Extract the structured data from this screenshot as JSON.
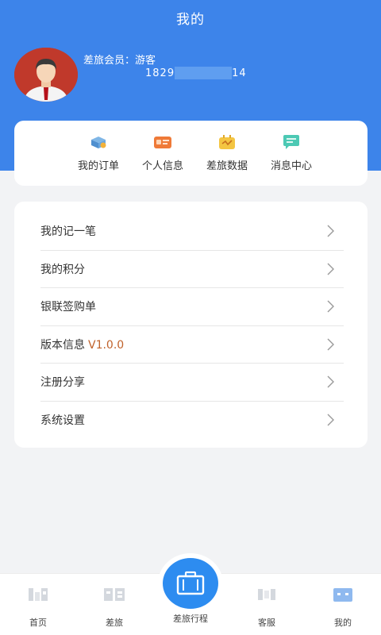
{
  "header": {
    "title": "我的",
    "member_label": "差旅会员：游客",
    "phone_prefix": "1829",
    "phone_suffix": "14",
    "accent_color": "#3d84ea"
  },
  "quick_actions": [
    {
      "label": "我的订单",
      "icon": "order-icon"
    },
    {
      "label": "个人信息",
      "icon": "id-card-icon"
    },
    {
      "label": "差旅数据",
      "icon": "data-icon"
    },
    {
      "label": "消息中心",
      "icon": "message-icon"
    }
  ],
  "menu": {
    "items": [
      {
        "label": "我的记一笔"
      },
      {
        "label": "我的积分"
      },
      {
        "label": "银联签购单"
      },
      {
        "label": "版本信息",
        "version": "V1.0.0"
      },
      {
        "label": "注册分享"
      },
      {
        "label": "系统设置"
      }
    ]
  },
  "tabbar": {
    "tabs": [
      {
        "label": "首页",
        "icon": "home-icon"
      },
      {
        "label": "差旅",
        "icon": "travel-icon"
      },
      {
        "label": "差旅行程",
        "icon": "suitcase-icon"
      },
      {
        "label": "客服",
        "icon": "service-icon"
      },
      {
        "label": "我的",
        "icon": "profile-icon"
      }
    ]
  }
}
